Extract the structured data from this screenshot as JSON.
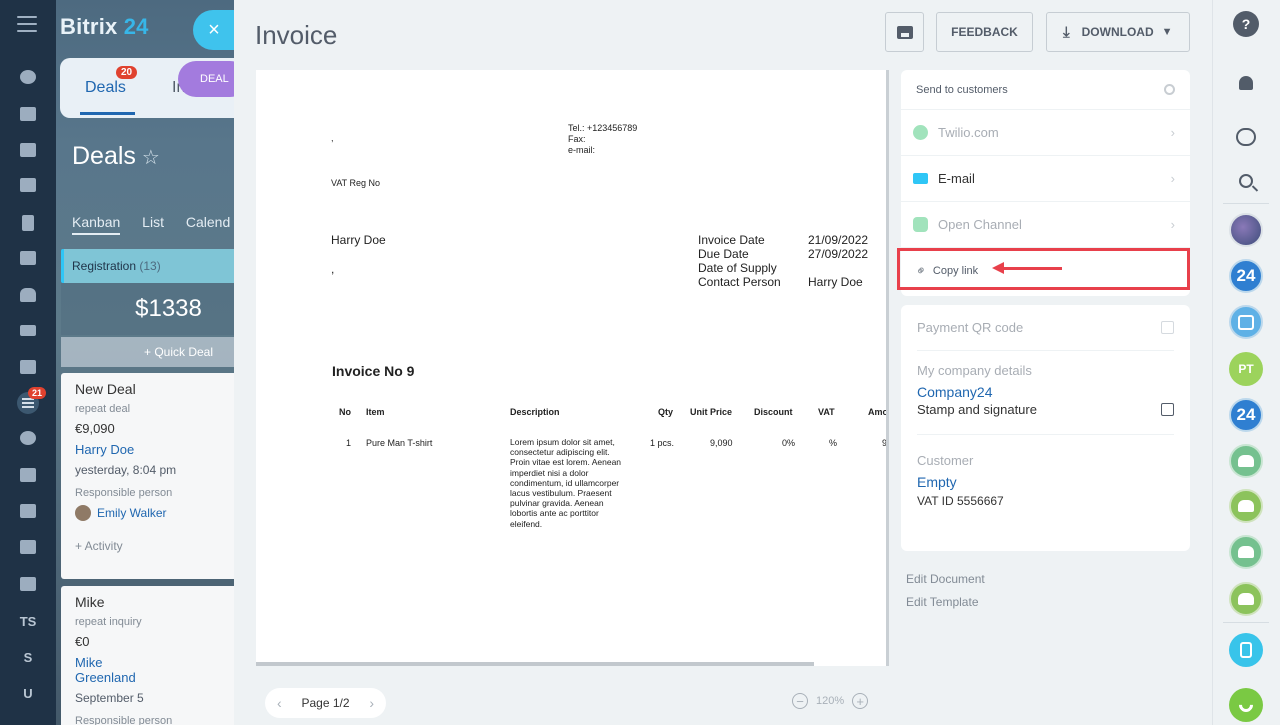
{
  "background": {
    "brand_name": "Bitrix",
    "brand_num": "24",
    "close_glyph": "×",
    "tabs": {
      "deals_label": "Deals",
      "deals_badge": "20",
      "in_label": "In",
      "deal_pill": "DEAL"
    },
    "page_title": "Deals",
    "star_glyph": "☆",
    "views": [
      "Kanban",
      "List",
      "Calend"
    ],
    "stage": {
      "name": "Registration",
      "count": "(13)",
      "sum": "$1338",
      "quick_deal": "+ Quick Deal"
    },
    "cards": [
      {
        "name": "New Deal",
        "subtitle": "repeat deal",
        "amount": "€9,090",
        "client": "Harry Doe",
        "time": "yesterday, 8:04 pm",
        "responsible_label": "Responsible person",
        "responsible": "Emily Walker",
        "activity": "+ Activity"
      },
      {
        "name": "Mike",
        "subtitle": "repeat inquiry",
        "amount": "€0",
        "client": "Mike Greenland",
        "time": "September 5",
        "responsible_label": "Responsible person"
      }
    ]
  },
  "leftbar": {
    "crm_badge": "21",
    "ts_label": "TS",
    "s_label": "S",
    "u_label": "U"
  },
  "invoice": {
    "title": "Invoice",
    "feedback_label": "FEEDBACK",
    "download_label": "DOWNLOAD",
    "document": {
      "comma1": ",",
      "tel": "Tel.: +123456789",
      "fax": "Fax:",
      "email": "e-mail:",
      "vat": "VAT Reg No",
      "client_name": "Harry Doe",
      "comma2": ",",
      "meta": [
        {
          "label": "Invoice Date",
          "value": "21/09/2022"
        },
        {
          "label": "Due Date",
          "value": "27/09/2022"
        },
        {
          "label": "Date of Supply",
          "value": ""
        },
        {
          "label": "Contact Person",
          "value": "Harry Doe"
        }
      ],
      "invoice_no": "Invoice No 9",
      "columns": [
        "No",
        "Item",
        "Description",
        "Qty",
        "Unit Price",
        "Discount",
        "VAT",
        "Amo"
      ],
      "row": {
        "no": "1",
        "item": "Pure Man T-shirt",
        "description": "Lorem ipsum dolor sit amet, consectetur adipiscing elit. Proin vitae est lorem. Aenean imperdiet nisi a dolor condimentum, id ullamcorper lacus vestibulum. Praesent pulvinar gravida. Aenean lobortis ante ac porttitor eleifend.",
        "qty": "1 pcs.",
        "unit_price": "9,090",
        "discount": "0%",
        "vat": "%",
        "amount": "9"
      }
    },
    "pager": {
      "label": "Page 1/2",
      "prev": "‹",
      "next": "›"
    },
    "zoom": {
      "value": "120%",
      "minus": "−",
      "plus": "+"
    },
    "send_panel": {
      "header": "Send to customers",
      "items": [
        {
          "label": "Twilio.com",
          "icon": "whatsapp-icon"
        },
        {
          "label": "E-mail",
          "icon": "mail-icon"
        },
        {
          "label": "Open Channel",
          "icon": "open-channel-icon"
        }
      ],
      "chevron": "›",
      "copy_link": "Copy link",
      "link_glyph": "⚭"
    },
    "settings_panel": {
      "payment_qr": "Payment QR code",
      "company_label": "My company details",
      "company_name": "Company24",
      "stamp_label": "Stamp and signature",
      "customer_label": "Customer",
      "customer_value": "Empty",
      "vat_id": "VAT ID 5556667"
    },
    "edit_document": "Edit Document",
    "edit_template": "Edit Template"
  },
  "rightbar": {
    "help": "?",
    "b24": "24",
    "pt": "PT"
  },
  "annotation_color": "#e8404b"
}
